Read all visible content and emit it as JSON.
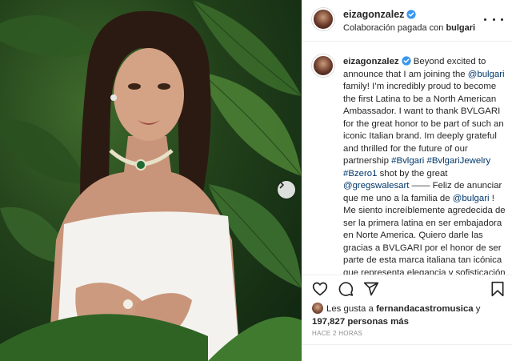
{
  "post": {
    "author": "eizagonzalez",
    "paid_partnership_prefix": "Colaboración pagada con ",
    "paid_partnership_brand": "bulgari"
  },
  "caption": {
    "username": "eizagonzalez",
    "segments": [
      {
        "t": " Beyond excited to announce that I am joining the "
      },
      {
        "t": "@bulgari",
        "link": true
      },
      {
        "t": " family! I’m incredibly proud to become the first Latina to be a North American Ambassador. I want to thank BVLGARI for the great honor to be part of such an iconic Italian brand. Im deeply grateful and thrilled for the future of our partnership "
      },
      {
        "t": "#Bvlgari",
        "link": true
      },
      {
        "t": " "
      },
      {
        "t": "#BvlgariJewelry",
        "link": true
      },
      {
        "t": " "
      },
      {
        "t": "#Bzero1",
        "link": true
      },
      {
        "t": " shot by the great "
      },
      {
        "t": "@gregswalesart",
        "link": true
      },
      {
        "t": " —— Feliz de anunciar que me uno a la familia de "
      },
      {
        "t": "@bulgari",
        "link": true
      },
      {
        "t": " ! Me siento increíblemente agredecida de ser la primera latina en ser embajadora en Norte America. Quiero darle las gracias a BVLGARI por el honor de ser parte de esta marca italiana tan icónica que representa elegancia y sofisticación alrededor del mundo."
      }
    ]
  },
  "likes": {
    "prefix": "Les gusta a ",
    "user": "fernandacastromusica",
    "middle": " y",
    "count": "197,827 personas más"
  },
  "timestamp": "HACE 2 HORAS",
  "icons": [
    "verified-badge-icon",
    "more-options-icon",
    "heart-icon",
    "comment-icon",
    "share-icon",
    "bookmark-icon",
    "chevron-right-icon"
  ],
  "colors": {
    "link": "#00376b",
    "verified": "#3897f0",
    "text": "#262626",
    "muted": "#8e8e8e"
  }
}
